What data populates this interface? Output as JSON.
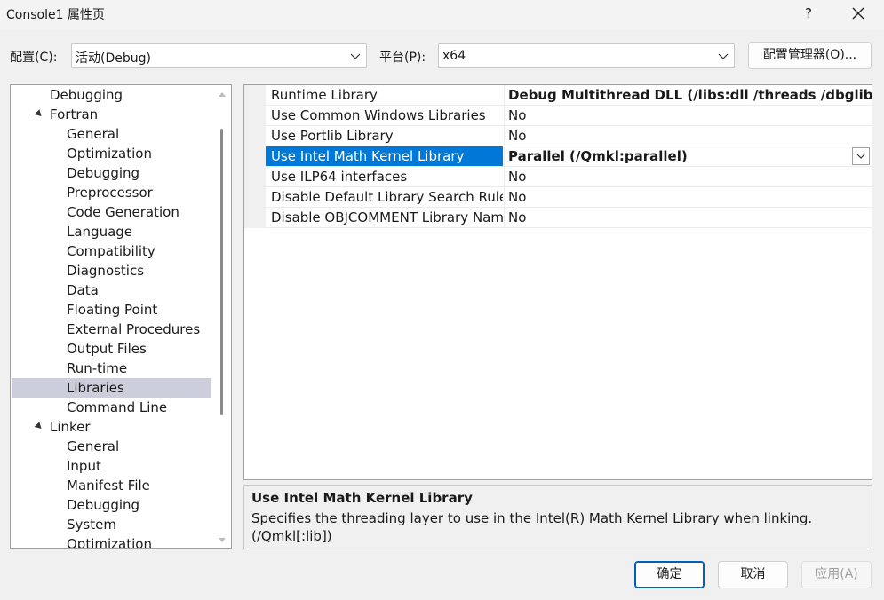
{
  "window": {
    "title": "Console1 属性页",
    "help": "?"
  },
  "toolbar": {
    "config_label": "配置(C):",
    "config_value": "活动(Debug)",
    "platform_label": "平台(P):",
    "platform_value": "x64",
    "manager_button": "配置管理器(O)..."
  },
  "tree": [
    {
      "label": "Debugging",
      "level": 1,
      "arrow": false
    },
    {
      "label": "Fortran",
      "level": 1,
      "arrow": true
    },
    {
      "label": "General",
      "level": 2,
      "arrow": false
    },
    {
      "label": "Optimization",
      "level": 2,
      "arrow": false
    },
    {
      "label": "Debugging",
      "level": 2,
      "arrow": false
    },
    {
      "label": "Preprocessor",
      "level": 2,
      "arrow": false
    },
    {
      "label": "Code Generation",
      "level": 2,
      "arrow": false
    },
    {
      "label": "Language",
      "level": 2,
      "arrow": false
    },
    {
      "label": "Compatibility",
      "level": 2,
      "arrow": false
    },
    {
      "label": "Diagnostics",
      "level": 2,
      "arrow": false
    },
    {
      "label": "Data",
      "level": 2,
      "arrow": false
    },
    {
      "label": "Floating Point",
      "level": 2,
      "arrow": false
    },
    {
      "label": "External Procedures",
      "level": 2,
      "arrow": false
    },
    {
      "label": "Output Files",
      "level": 2,
      "arrow": false
    },
    {
      "label": "Run-time",
      "level": 2,
      "arrow": false
    },
    {
      "label": "Libraries",
      "level": 2,
      "arrow": false,
      "selected": true
    },
    {
      "label": "Command Line",
      "level": 2,
      "arrow": false
    },
    {
      "label": "Linker",
      "level": 1,
      "arrow": true
    },
    {
      "label": "General",
      "level": 2,
      "arrow": false
    },
    {
      "label": "Input",
      "level": 2,
      "arrow": false
    },
    {
      "label": "Manifest File",
      "level": 2,
      "arrow": false
    },
    {
      "label": "Debugging",
      "level": 2,
      "arrow": false
    },
    {
      "label": "System",
      "level": 2,
      "arrow": false
    },
    {
      "label": "Optimization",
      "level": 2,
      "arrow": false
    }
  ],
  "properties": [
    {
      "name": "Runtime Library",
      "value": "Debug Multithread DLL (/libs:dll /threads /dbglibs)",
      "bold": true
    },
    {
      "name": "Use Common Windows Libraries",
      "value": "No",
      "bold": false
    },
    {
      "name": "Use Portlib Library",
      "value": "No",
      "bold": false
    },
    {
      "name": "Use Intel Math Kernel Library",
      "value": "Parallel (/Qmkl:parallel)",
      "bold": true,
      "selected": true
    },
    {
      "name": "Use ILP64 interfaces",
      "value": "No",
      "bold": false
    },
    {
      "name": "Disable Default Library Search Rules",
      "value": "No",
      "bold": false
    },
    {
      "name": "Disable OBJCOMMENT Library Name",
      "value": "No",
      "bold": false
    }
  ],
  "description": {
    "title": "Use Intel Math Kernel Library",
    "text_line1": "Specifies the threading layer to use in the Intel(R) Math Kernel Library when linking.",
    "text_line2": "(/Qmkl[:lib])"
  },
  "buttons": {
    "ok": "确定",
    "cancel": "取消",
    "apply": "应用(A)"
  },
  "colors": {
    "selection": "#0078d7",
    "tree_selection": "#cccedb",
    "primary_border": "#005fb8"
  }
}
